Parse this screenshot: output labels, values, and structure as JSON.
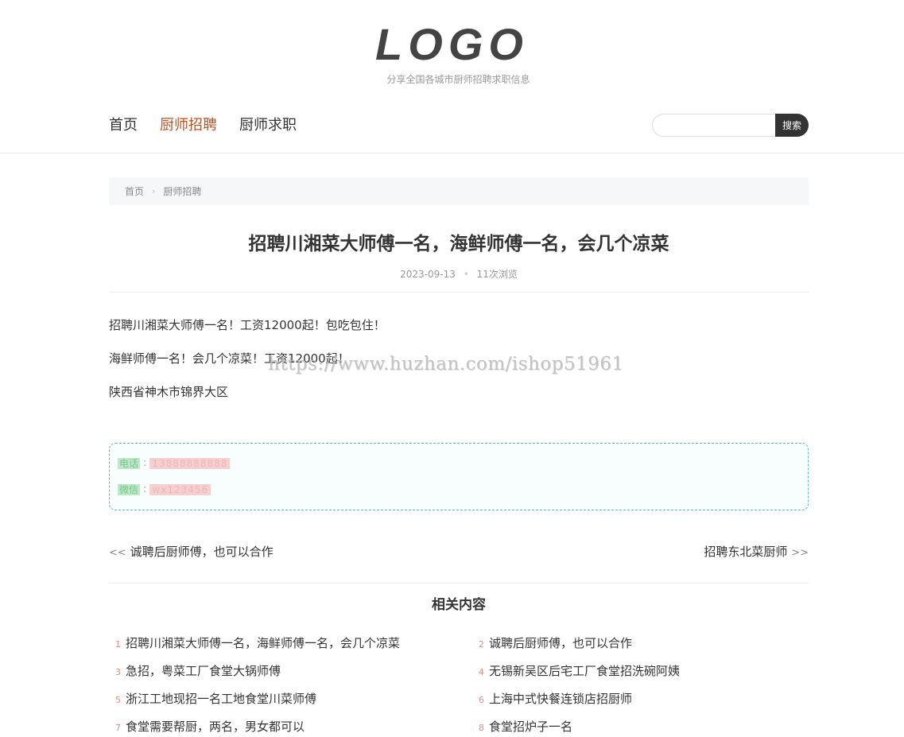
{
  "site": {
    "logo": "LOGO",
    "tagline": "分享全国各城市厨师招聘求职信息"
  },
  "nav": {
    "items": [
      {
        "label": "首页"
      },
      {
        "label": "厨师招聘"
      },
      {
        "label": "厨师求职"
      }
    ]
  },
  "search": {
    "placeholder": "",
    "button_label": "搜索"
  },
  "breadcrumb": {
    "home": "首页",
    "current": "厨师招聘"
  },
  "article": {
    "title": "招聘川湘菜大师傅一名，海鲜师傅一名，会几个凉菜",
    "date": "2023-09-13",
    "views": "11次浏览",
    "paragraphs": [
      "招聘川湘菜大师傅一名！工资12000起！包吃包住！",
      "海鲜师傅一名！会几个凉菜！工资12000起！",
      "陕西省神木市锦界大区"
    ]
  },
  "watermark": "https://www.huzhan.com/ishop51961",
  "contact": {
    "phone_label": "电话",
    "phone_value": "13888888888",
    "wechat_label": "微信",
    "wechat_value": "wx123456"
  },
  "navigation": {
    "prev_arrow": "<<",
    "prev_title": "诚聘后厨师傅，也可以合作",
    "next_title": "招聘东北菜厨师",
    "next_arrow": ">>"
  },
  "related": {
    "title": "相关内容",
    "items": [
      {
        "num": "1",
        "title": "招聘川湘菜大师傅一名，海鲜师傅一名，会几个凉菜"
      },
      {
        "num": "2",
        "title": "诚聘后厨师傅，也可以合作"
      },
      {
        "num": "3",
        "title": "急招，粤菜工厂食堂大锅师傅"
      },
      {
        "num": "4",
        "title": "无锡新吴区后宅工厂食堂招洗碗阿姨"
      },
      {
        "num": "5",
        "title": "浙江工地现招一名工地食堂川菜师傅"
      },
      {
        "num": "6",
        "title": "上海中式快餐连锁店招厨师"
      },
      {
        "num": "7",
        "title": "食堂需要帮厨，两名，男女都可以"
      },
      {
        "num": "8",
        "title": "食堂招炉子一名"
      }
    ]
  }
}
